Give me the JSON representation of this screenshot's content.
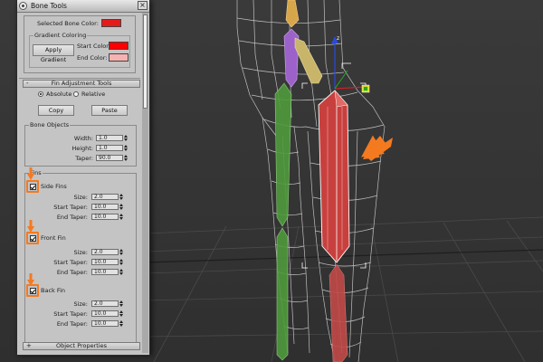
{
  "window": {
    "title": "Bone Tools",
    "close_glyph": "×",
    "icon": "app-icon"
  },
  "bone_color": {
    "selected_label": "Selected Bone Color:",
    "selected_color": "#e51a1a"
  },
  "gradient": {
    "group_label": "Gradient Coloring",
    "apply_button": "Apply Gradient",
    "start_label": "Start Color:",
    "start_color": "#ff0000",
    "end_label": "End Color:",
    "end_color": "#f6b2b2"
  },
  "fin_adjustment": {
    "rollout_title": "Fin Adjustment Tools",
    "rollout_sign": "-",
    "mode_absolute": "Absolute",
    "mode_relative": "Relative",
    "selected_mode": "Absolute",
    "copy_button": "Copy",
    "paste_button": "Paste"
  },
  "bone_objects": {
    "group_label": "Bone Objects",
    "width_label": "Width:",
    "width_value": "1.0",
    "height_label": "Height:",
    "height_value": "1.0",
    "taper_label": "Taper:",
    "taper_value": "90.0"
  },
  "fins": {
    "group_label": "Fins",
    "side": {
      "label": "Side Fins",
      "checked": true,
      "size_label": "Size:",
      "size_value": "2.0",
      "start_label": "Start Taper:",
      "start_value": "10.0",
      "end_label": "End Taper:",
      "end_value": "10.0"
    },
    "front": {
      "label": "Front Fin",
      "checked": true,
      "size_label": "Size:",
      "size_value": "2.0",
      "start_label": "Start Taper:",
      "start_value": "10.0",
      "end_label": "End Taper:",
      "end_value": "10.0"
    },
    "back": {
      "label": "Back Fin",
      "checked": true,
      "size_label": "Size:",
      "size_value": "2.0",
      "start_label": "Start Taper:",
      "start_value": "10.0",
      "end_label": "End Taper:",
      "end_value": "10.0"
    }
  },
  "object_properties": {
    "rollout_title": "Object Properties",
    "rollout_sign": "+"
  },
  "colors": {
    "highlight": "#f47a20",
    "panel": "#c4c4c4",
    "viewport_bg": "#3a3a3a"
  }
}
